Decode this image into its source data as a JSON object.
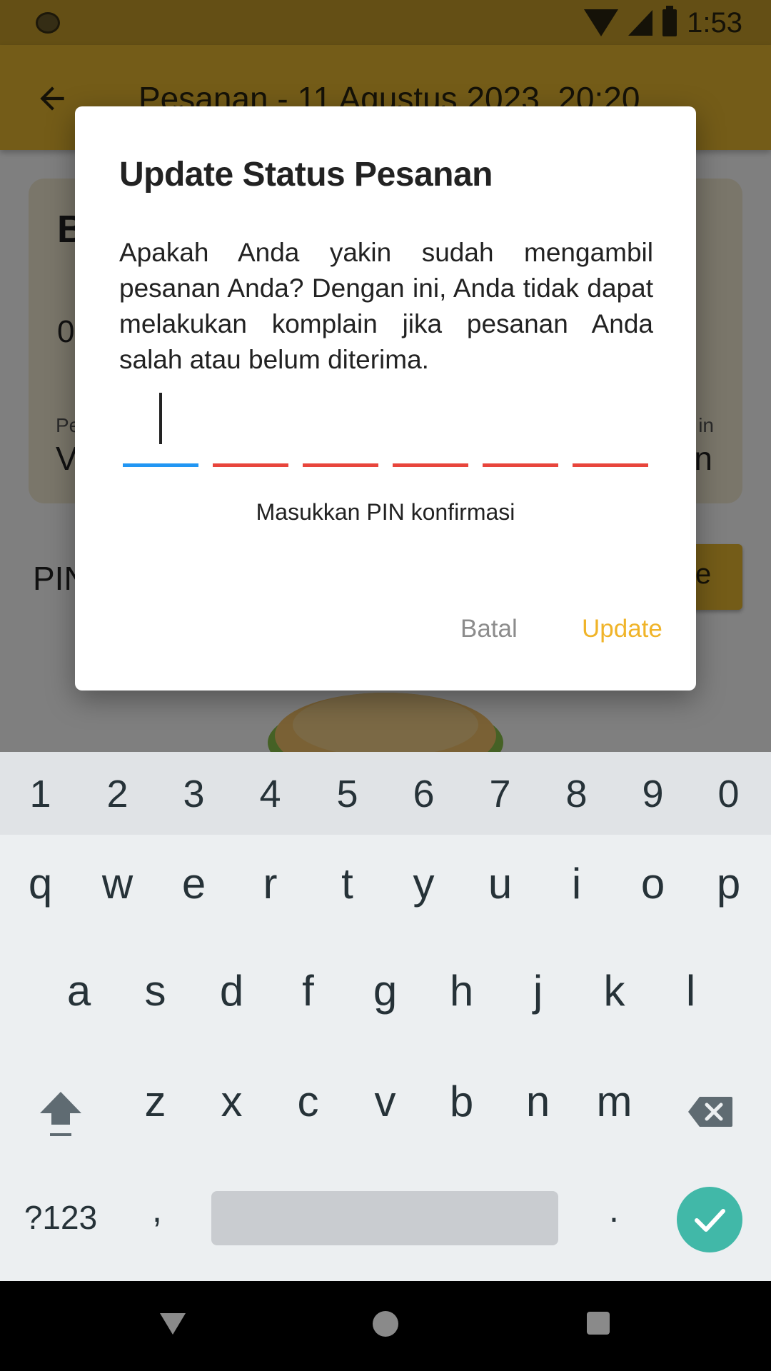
{
  "status_bar": {
    "time": "1:53"
  },
  "app_bar": {
    "title": "Pesanan - 11 Agustus 2023, 20:20"
  },
  "background": {
    "card_letter": "B",
    "card_digit": "0",
    "card_small_left": "Pe",
    "card_value_left": "V",
    "card_small_right": "in",
    "card_value_right": "n",
    "pin_label": "PIN",
    "update_button_partial": "e"
  },
  "dialog": {
    "title": "Update Status Pesanan",
    "message": "Apakah Anda yakin sudah mengambil pesanan Anda? Dengan ini, Anda tidak dapat melakukan komplain jika pesanan Anda salah atau belum diterima.",
    "pin_hint": "Masukkan PIN konfirmasi",
    "pin_length": 6,
    "cancel_label": "Batal",
    "update_label": "Update"
  },
  "keyboard": {
    "numbers": [
      "1",
      "2",
      "3",
      "4",
      "5",
      "6",
      "7",
      "8",
      "9",
      "0"
    ],
    "row1": [
      "q",
      "w",
      "e",
      "r",
      "t",
      "y",
      "u",
      "i",
      "o",
      "p"
    ],
    "row2": [
      "a",
      "s",
      "d",
      "f",
      "g",
      "h",
      "j",
      "k",
      "l"
    ],
    "row3": [
      "z",
      "x",
      "c",
      "v",
      "b",
      "n",
      "m"
    ],
    "symbols_label": "?123",
    "comma": ",",
    "period": "."
  },
  "colors": {
    "accent": "#f0b429",
    "pin_active_line": "#2196f3",
    "pin_line": "#e8453c",
    "enter_key": "#41b8a8"
  }
}
